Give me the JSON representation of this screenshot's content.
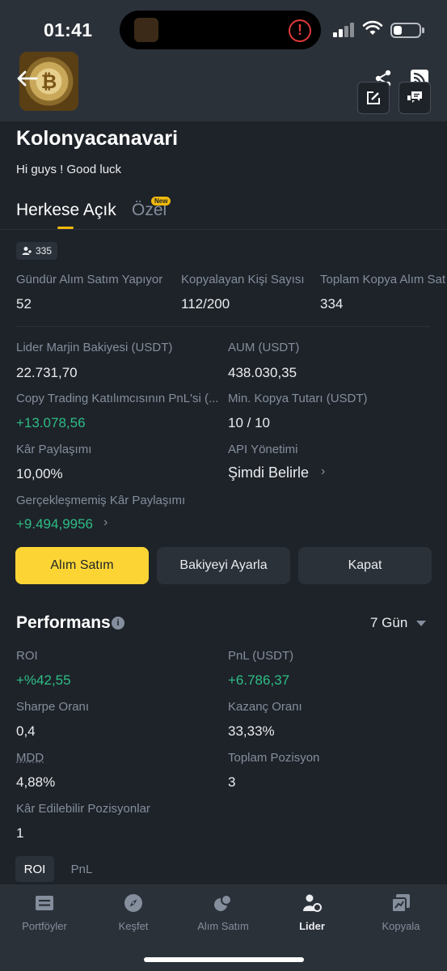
{
  "status_bar": {
    "time": "01:41"
  },
  "profile": {
    "username": "Kolonyacanavari",
    "bio": "Hi guys ! Good luck",
    "followers": "335"
  },
  "tabs": {
    "public": "Herkese Açık",
    "private": "Özel",
    "new_badge": "New"
  },
  "stats_row": [
    {
      "label": "Gündür Alım Satım Yapıyor",
      "value": "52"
    },
    {
      "label": "Kopyalayan Kişi Sayısı",
      "value": "112/200"
    },
    {
      "label": "Toplam Kopya Alım Sat",
      "value": "334"
    }
  ],
  "details": {
    "margin_balance": {
      "label": "Lider Marjin Bakiyesi (USDT)",
      "value": "22.731,70"
    },
    "aum": {
      "label": "AUM (USDT)",
      "value": "438.030,35"
    },
    "participant_pnl": {
      "label": "Copy Trading Katılımcısının PnL'si (...",
      "value": "+13.078,56"
    },
    "min_copy": {
      "label": "Min. Kopya Tutarı (USDT)",
      "value": "10 / 10"
    },
    "profit_share": {
      "label": "Kâr Paylaşımı",
      "value": "10,00%"
    },
    "api": {
      "label": "API Yönetimi",
      "value": "Şimdi Belirle"
    },
    "unrealized_share": {
      "label": "Gerçekleşmemiş Kâr Paylaşımı",
      "value": "+9.494,9956"
    }
  },
  "buttons": {
    "trade": "Alım Satım",
    "adjust_balance": "Bakiyeyi Ayarla",
    "close": "Kapat"
  },
  "performance": {
    "title": "Performans",
    "period": "7 Gün",
    "roi": {
      "label": "ROI",
      "value": "+%42,55"
    },
    "pnl": {
      "label": "PnL (USDT)",
      "value": "+6.786,37"
    },
    "sharpe": {
      "label": "Sharpe Oranı",
      "value": "0,4"
    },
    "win_rate": {
      "label": "Kazanç Oranı",
      "value": "33,33%"
    },
    "mdd": {
      "label": "MDD",
      "value": "4,88%"
    },
    "total_positions": {
      "label": "Toplam Pozisyon",
      "value": "3"
    },
    "profitable_positions": {
      "label": "Kâr Edilebilir Pozisyonlar",
      "value": "1"
    }
  },
  "subtabs": {
    "roi": "ROI",
    "pnl": "PnL"
  },
  "bottom_nav": [
    {
      "label": "Portföyler",
      "icon": "portfolio-icon"
    },
    {
      "label": "Keşfet",
      "icon": "compass-icon"
    },
    {
      "label": "Alım Satım",
      "icon": "trade-icon"
    },
    {
      "label": "Lider",
      "icon": "leader-icon",
      "active": true
    },
    {
      "label": "Kopyala",
      "icon": "copy-icon"
    }
  ],
  "colors": {
    "background": "#1e2329",
    "surface": "#2b3139",
    "accent": "#f0b90b",
    "primary_button": "#fcd535",
    "positive": "#2ebd85",
    "muted_text": "#848e9c"
  }
}
